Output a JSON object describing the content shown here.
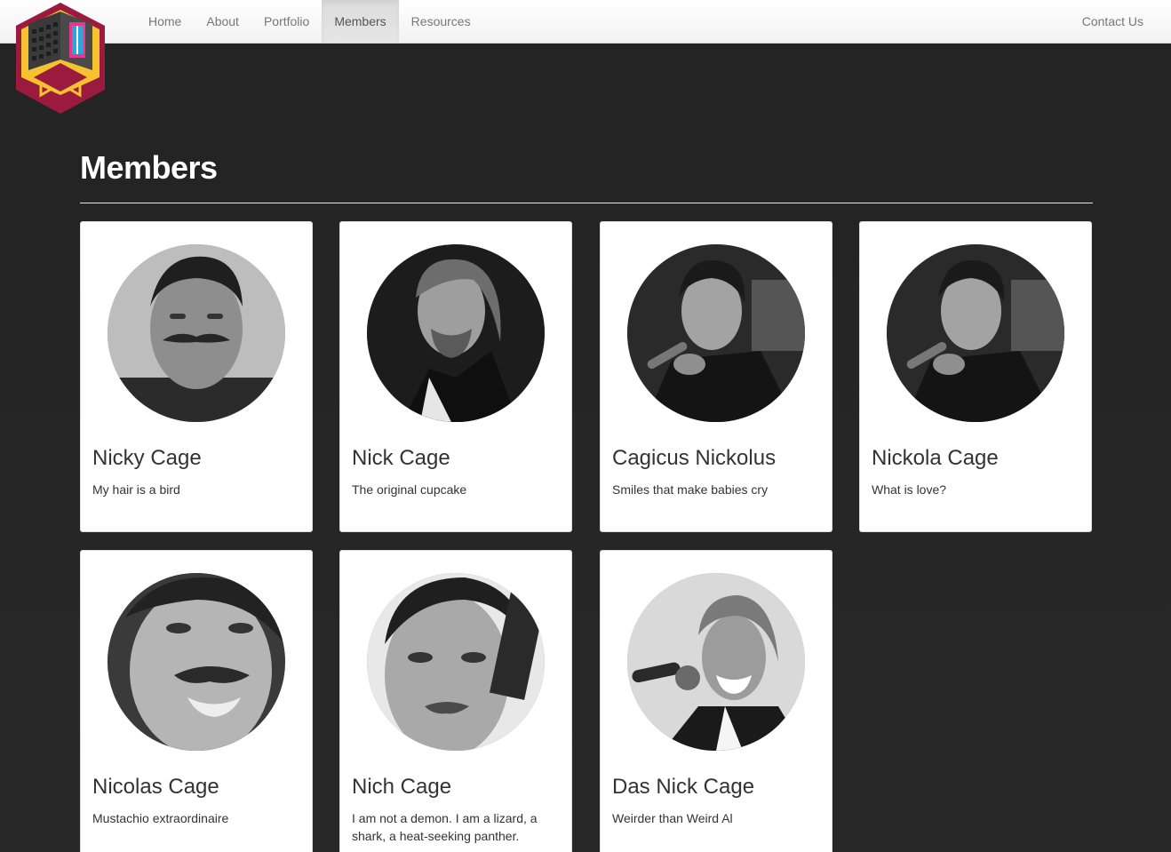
{
  "nav": {
    "items": [
      {
        "label": "Home",
        "active": false
      },
      {
        "label": "About",
        "active": false
      },
      {
        "label": "Portfolio",
        "active": false
      },
      {
        "label": "Members",
        "active": true
      },
      {
        "label": "Resources",
        "active": false
      }
    ],
    "contact_label": "Contact Us"
  },
  "colors": {
    "logo_red": "#9b1b3f",
    "logo_yellow": "#f7c22f",
    "logo_dark": "#3a3a3a",
    "logo_pink": "#e8368f",
    "logo_cyan": "#2aa6d8",
    "page_background": "#262626"
  },
  "page": {
    "title": "Members"
  },
  "members": [
    {
      "name": "Nicky Cage",
      "tagline": "My hair is a bird"
    },
    {
      "name": "Nick Cage",
      "tagline": "The original cupcake"
    },
    {
      "name": "Cagicus Nickolus",
      "tagline": "Smiles that make babies cry"
    },
    {
      "name": "Nickola Cage",
      "tagline": "What is love?"
    },
    {
      "name": "Nicolas Cage",
      "tagline": "Mustachio extraordinaire"
    },
    {
      "name": "Nich Cage",
      "tagline": "I am not a demon. I am a lizard, a shark, a heat-seeking panther."
    },
    {
      "name": "Das Nick Cage",
      "tagline": "Weirder than Weird Al"
    }
  ]
}
